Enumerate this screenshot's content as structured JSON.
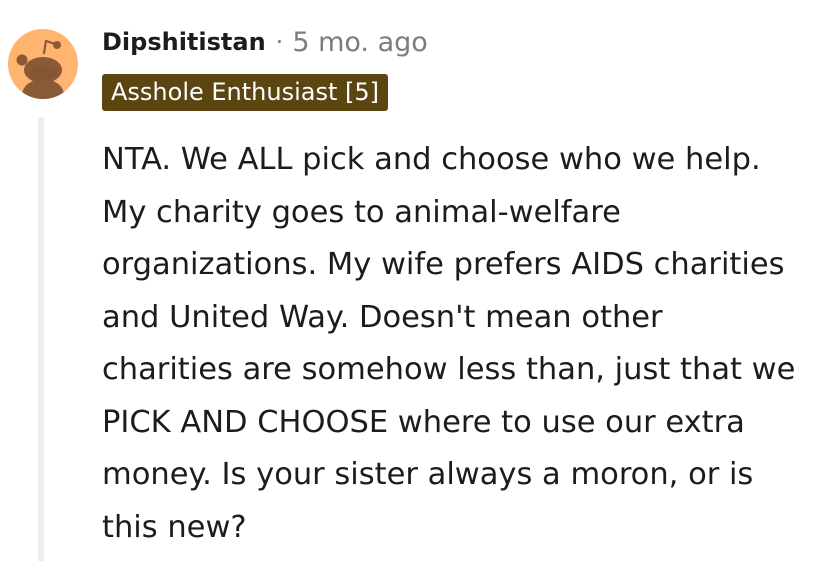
{
  "comment": {
    "username": "Dipshitistan",
    "separator": "·",
    "timestamp": "5 mo. ago",
    "flair": "Asshole Enthusiast [5]",
    "avatar_icon": "snoo-avatar-icon",
    "body": "NTA. We ALL pick and choose who we help. My charity goes to animal-welfare organizations. My wife prefers AIDS charities and United Way. Doesn't mean other charities are somehow less than, just that we PICK AND CHOOSE where to use our extra money. Is your sister always a moron, or is this new?"
  },
  "colors": {
    "flair_background": "#5b4511",
    "avatar_background": "#ffb470",
    "thread_line": "#ededed",
    "meta_text": "#7c7c7c"
  }
}
